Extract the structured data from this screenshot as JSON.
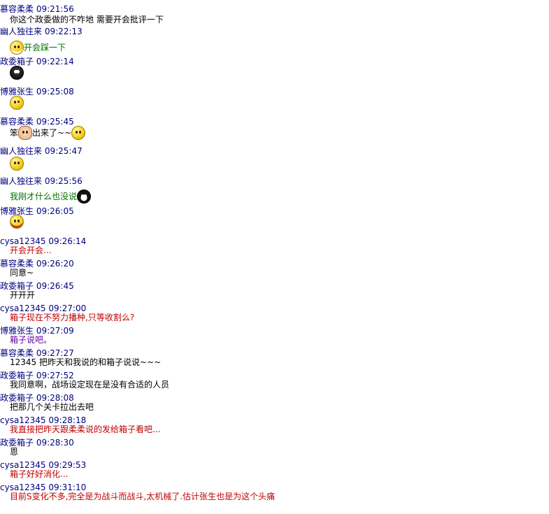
{
  "colors": {
    "header": "#000080",
    "black": "#000000",
    "green": "#007000",
    "red": "#c00000",
    "purple": "#660099"
  },
  "messages": [
    {
      "name": "慕容柔柔",
      "time": "09:21:56",
      "text": "你这个政委做的不咋地 需要开会批评一下",
      "color": "#000000",
      "emoji": "",
      "emoji_after": ""
    },
    {
      "name": " 幽人独往来",
      "time": "09:22:13",
      "text": "开会踩一下",
      "color": "#007000",
      "emoji": "grin-face-icon",
      "emoji_after": ""
    },
    {
      "name": "政委箱子",
      "time": "09:22:14",
      "text": "",
      "color": "#000000",
      "emoji": "owl-face-icon",
      "emoji_after": ""
    },
    {
      "name": "博雅张生",
      "time": "09:25:08",
      "text": "",
      "color": "#000000",
      "emoji": "shocked-face-icon",
      "emoji_after": ""
    },
    {
      "name": "慕容柔柔",
      "time": "09:25:45",
      "text": "笨",
      "text2": "出来了~~",
      "color": "#000000",
      "emoji": "",
      "emoji_mid": "pig-face-icon",
      "emoji_after": "wave-face-icon"
    },
    {
      "name": " 幽人独往来",
      "time": "09:25:47",
      "text": "",
      "color": "#000000",
      "emoji": "dizzy-face-icon",
      "emoji_after": ""
    },
    {
      "name": " 幽人独往来",
      "time": "09:25:56",
      "text": "我刚才什么也没说",
      "color": "#007000",
      "emoji": "",
      "emoji_after": "penguin-icon"
    },
    {
      "name": "博雅张生",
      "time": "09:26:05",
      "text": "",
      "color": "#000000",
      "emoji": "yawn-face-icon",
      "emoji_after": ""
    },
    {
      "name": "cysa12345",
      "time": "09:26:14",
      "text": "开会开会...",
      "color": "#c00000",
      "emoji": "",
      "emoji_after": ""
    },
    {
      "name": "慕容柔柔",
      "time": "09:26:20",
      "text": "同意~",
      "color": "#000000",
      "emoji": "",
      "emoji_after": ""
    },
    {
      "name": "政委箱子",
      "time": "09:26:45",
      "text": "开开开",
      "color": "#000000",
      "emoji": "",
      "emoji_after": ""
    },
    {
      "name": "cysa12345",
      "time": "09:27:00",
      "text": "箱子现在不努力播种,只等收割么?",
      "color": "#c00000",
      "emoji": "",
      "emoji_after": ""
    },
    {
      "name": "博雅张生",
      "time": "09:27:09",
      "text": "箱子说吧。",
      "color": "#660099",
      "emoji": "",
      "emoji_after": ""
    },
    {
      "name": "慕容柔柔",
      "time": "09:27:27",
      "text": "12345 把昨天和我说的和箱子说说~~~",
      "color": "#000000",
      "emoji": "",
      "emoji_after": ""
    },
    {
      "name": "政委箱子",
      "time": "09:27:52",
      "text": "我同意啊，战场设定现在是没有合适的人员",
      "color": "#000000",
      "emoji": "",
      "emoji_after": ""
    },
    {
      "name": "政委箱子",
      "time": "09:28:08",
      "text": "把那几个关卡拉出去吧",
      "color": "#000000",
      "emoji": "",
      "emoji_after": ""
    },
    {
      "name": "cysa12345",
      "time": "09:28:18",
      "text": "我直接把昨天跟柔柔说的发给箱子看吧...",
      "color": "#c00000",
      "emoji": "",
      "emoji_after": ""
    },
    {
      "name": "政委箱子",
      "time": "09:28:30",
      "text": "恩",
      "color": "#000000",
      "emoji": "",
      "emoji_after": ""
    },
    {
      "name": "cysa12345",
      "time": "09:29:53",
      "text": "箱子好好消化...",
      "color": "#c00000",
      "emoji": "",
      "emoji_after": ""
    },
    {
      "name": "cysa12345",
      "time": "09:31:10",
      "text": "目前S变化不多,完全是为战斗而战斗,太机械了.估计张生也是为这个头痛",
      "color": "#c00000",
      "emoji": "",
      "emoji_after": ""
    }
  ]
}
